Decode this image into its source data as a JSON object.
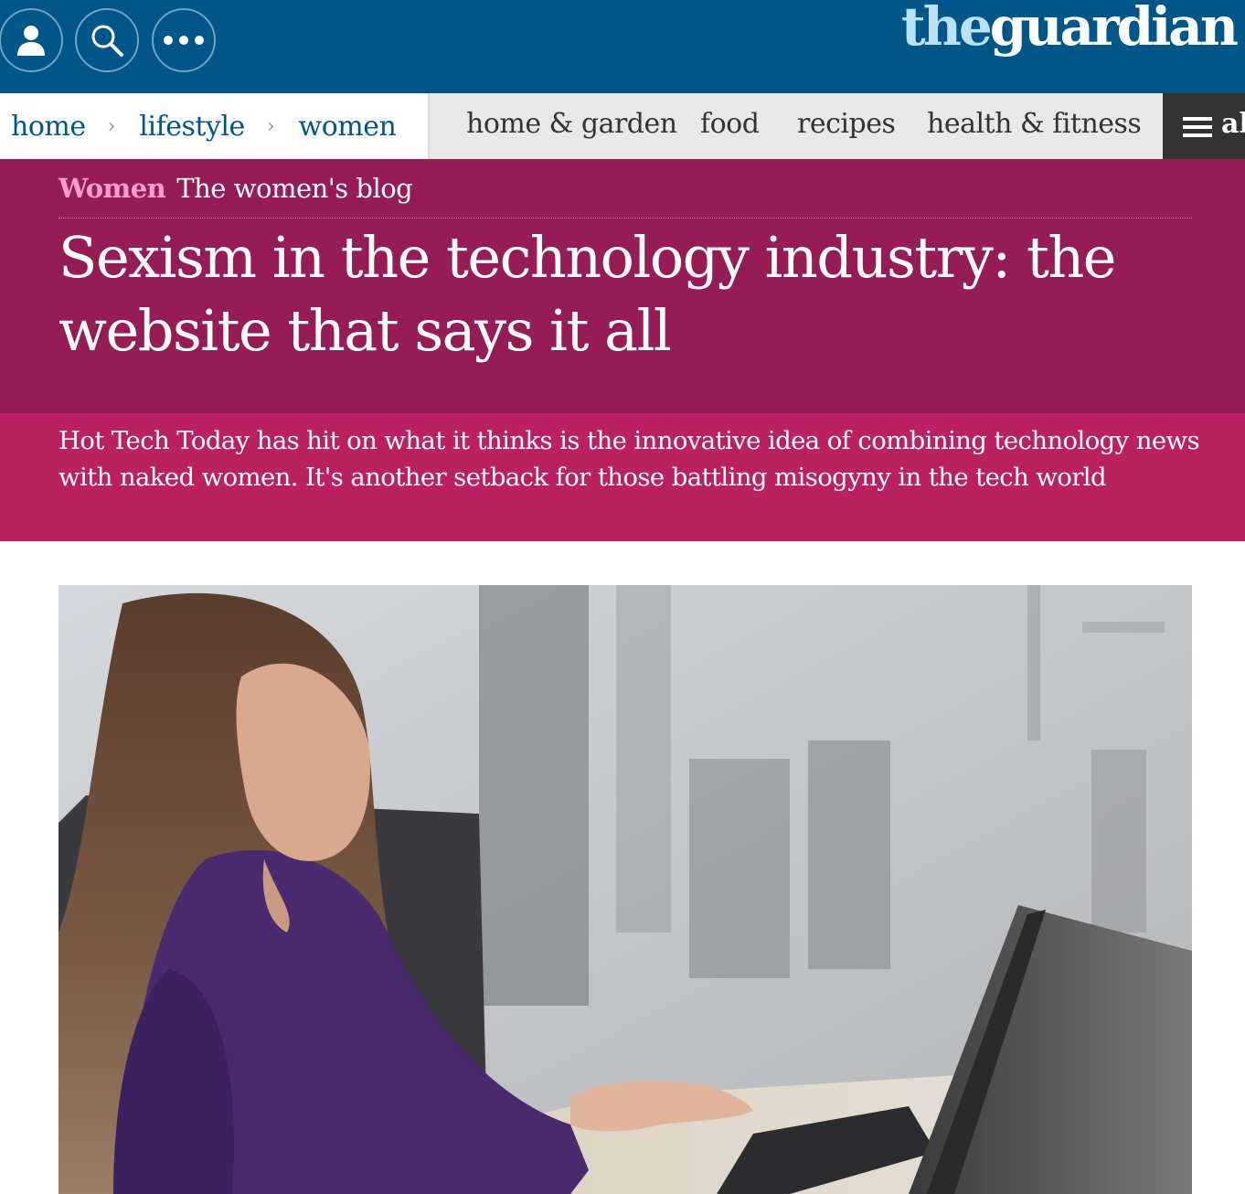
{
  "topbar": {
    "logo_the": "the",
    "logo_guardian": "guardian",
    "buttons": [
      {
        "icon": "account-icon"
      },
      {
        "icon": "search-icon"
      },
      {
        "icon": "more-dots-icon"
      }
    ]
  },
  "breadcrumbs": [
    "home",
    "lifestyle",
    "women"
  ],
  "breadcrumb_separator": "›",
  "sections": [
    "home & garden",
    "food",
    "recipes",
    "health & fitness"
  ],
  "all_button": {
    "label": "al",
    "icon": "hamburger-icon"
  },
  "article": {
    "section_label": "Women",
    "series_label": "The women's blog",
    "headline": "Sexism in the technology industry: the website that says it all",
    "standfirst": "Hot Tech Today has hit on what it thinks is the innovative idea of combining technology news with naked women. It's another setback for those battling misogyny in the tech world"
  },
  "colors": {
    "masthead": "#005689",
    "header_bg": "#951c55",
    "standfirst_bg": "#bb2060",
    "section_label": "#ff9fcb",
    "nav_link": "#005689"
  }
}
